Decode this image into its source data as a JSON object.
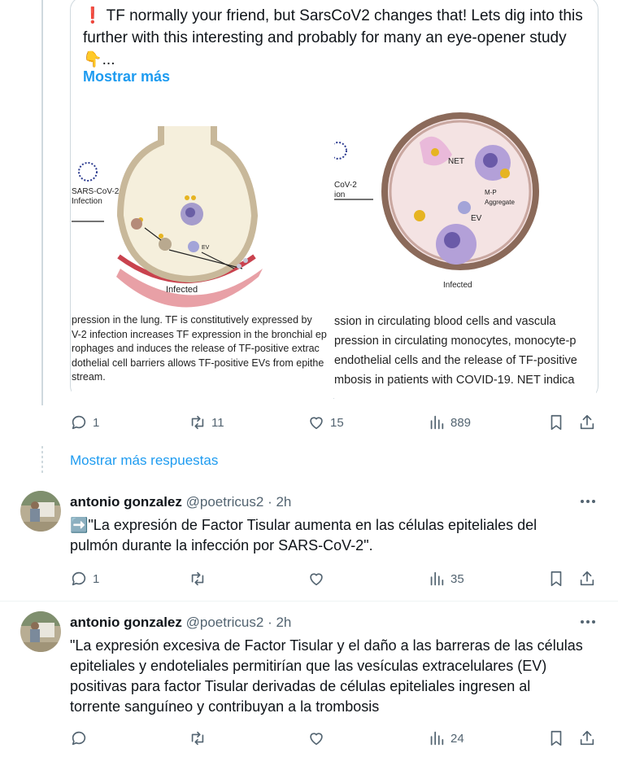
{
  "tweet": {
    "text_line1": "❗ TF normally your friend, but SarsCoV2 changes that! Lets dig into this",
    "text_line2": "further with this interesting and probably for many an eye-opener study",
    "text_line3": "👇...",
    "show_more": "Mostrar más",
    "figure_left": {
      "virus_label": "SARS-CoV-2\nInfection",
      "ev_label": "EV",
      "infected": "Infected",
      "caption": "pression in the lung. TF is constitutively expressed by\nV-2 infection increases TF expression in the bronchial ep\nrophages and induces the release of TF-positive extrac\ndothelial cell barriers allows TF-positive EVs from epithe\nstream."
    },
    "figure_right": {
      "virus_label": "CoV-2\nion",
      "net_label": "NET",
      "mp_label": "M-P\nAggregate",
      "ev_label": "EV",
      "infected": "Infected",
      "caption": "ssion in circulating blood cells and vascula\npression in circulating monocytes, monocyte-p\nendothelial cells and the release of TF-positive\nmbosis in patients with COVID-19. NET indica"
    },
    "stats": {
      "replies": "1",
      "reposts": "11",
      "likes": "15",
      "views": "889"
    }
  },
  "show_more_replies": "Mostrar más respuestas",
  "replies": [
    {
      "name": "antonio gonzalez",
      "handle": "@poetricus2",
      "dot": "·",
      "time": "2h",
      "text_line1": "➡️\"La expresión de Factor Tisular aumenta en las células epiteliales del",
      "text_line2": "pulmón durante la infección por SARS-CoV-2\".",
      "stats": {
        "replies": "1",
        "reposts": "",
        "likes": "",
        "views": "35"
      }
    },
    {
      "name": "antonio gonzalez",
      "handle": "@poetricus2",
      "dot": "·",
      "time": "2h",
      "text_line1": "\"La expresión excesiva de Factor Tisular y el daño a las barreras de las células",
      "text_line2": "epiteliales y endoteliales permitirían que las vesículas extracelulares (EV)",
      "text_line3": "positivas para factor Tisular derivadas de células epiteliales ingresen al",
      "text_line4": "torrente sanguíneo y contribuyan a la trombosis",
      "stats": {
        "replies": "",
        "reposts": "",
        "likes": "",
        "views": "24"
      }
    }
  ],
  "colors": {
    "accent": "#1d9bf0",
    "muted": "#536471",
    "border": "#cfd9de",
    "text": "#0f1419"
  },
  "icons": [
    "reply-icon",
    "repost-icon",
    "like-icon",
    "views-icon",
    "bookmark-icon",
    "share-icon",
    "more-icon"
  ]
}
